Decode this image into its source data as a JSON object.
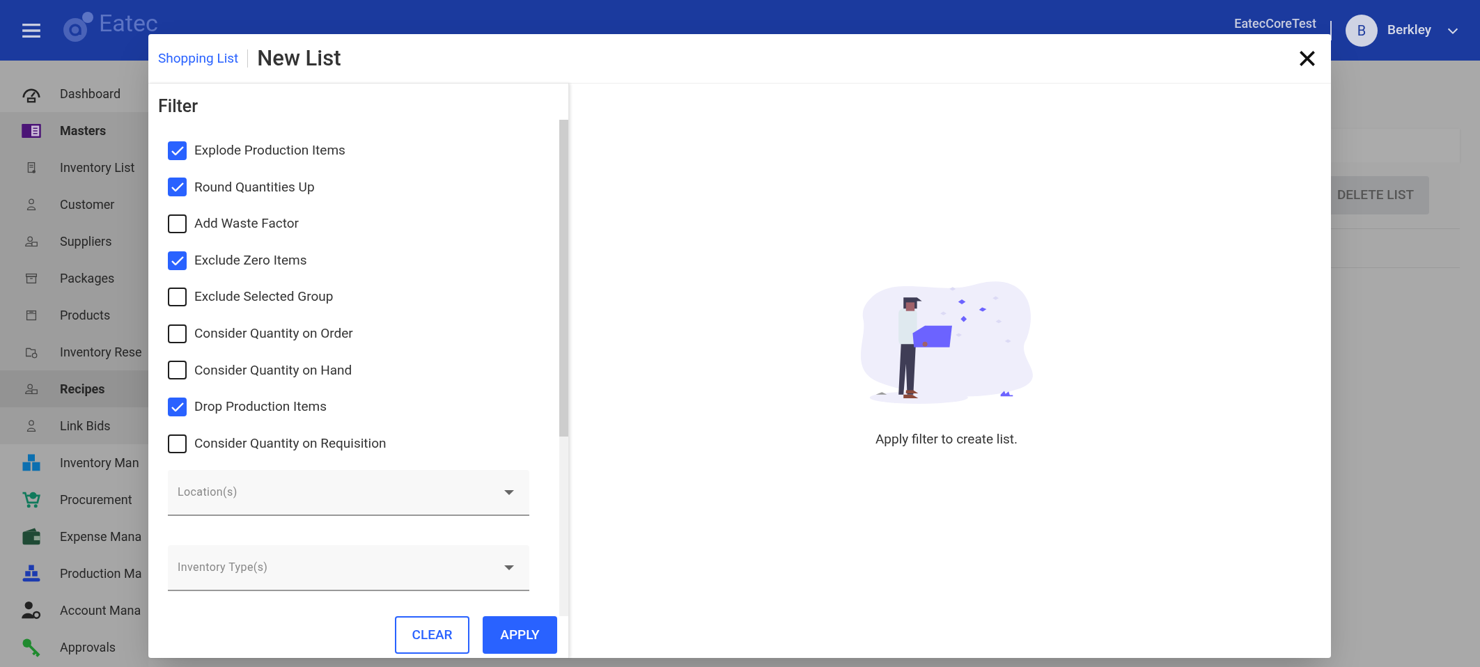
{
  "top_bar": {
    "app_name": "Eatec",
    "tenant": "EatecCoreTest",
    "user": {
      "initial": "B",
      "name": "Berkley"
    }
  },
  "sidebar": {
    "items": [
      {
        "label": "Dashboard",
        "kind": "link"
      },
      {
        "label": "Masters",
        "kind": "section",
        "expanded": true
      },
      {
        "label": "Inventory List",
        "kind": "subitem",
        "selected": false
      },
      {
        "label": "Customer",
        "kind": "subitem",
        "selected": false
      },
      {
        "label": "Suppliers",
        "kind": "subitem",
        "selected": false
      },
      {
        "label": "Packages",
        "kind": "subitem",
        "selected": false
      },
      {
        "label": "Products",
        "kind": "subitem",
        "selected": false
      },
      {
        "label": "Inventory Rese",
        "kind": "subitem",
        "selected": false
      },
      {
        "label": "Recipes",
        "kind": "subitem",
        "selected": true
      },
      {
        "label": "Link Bids",
        "kind": "subitem",
        "selected": false
      },
      {
        "label": "Inventory Man",
        "kind": "section",
        "expanded": false
      },
      {
        "label": "Procurement",
        "kind": "section",
        "expanded": false
      },
      {
        "label": "Expense Mana",
        "kind": "section",
        "expanded": false
      },
      {
        "label": "Production Ma",
        "kind": "section",
        "expanded": false
      },
      {
        "label": "Account Mana",
        "kind": "section",
        "expanded": false
      },
      {
        "label": "Approvals",
        "kind": "section",
        "expanded": false
      }
    ]
  },
  "background": {
    "delete_button": {
      "label": "DELETE LIST",
      "disabled": true
    }
  },
  "dialog": {
    "breadcrumb": "Shopping List",
    "title": "New List",
    "filter": {
      "title": "Filter",
      "options": [
        {
          "label": "Explode Production Items",
          "checked": true
        },
        {
          "label": "Round Quantities Up",
          "checked": true
        },
        {
          "label": "Add Waste Factor",
          "checked": false
        },
        {
          "label": "Exclude Zero Items",
          "checked": true
        },
        {
          "label": "Exclude Selected Group",
          "checked": false
        },
        {
          "label": "Consider Quantity on Order",
          "checked": false
        },
        {
          "label": "Consider Quantity on Hand",
          "checked": false
        },
        {
          "label": "Drop Production Items",
          "checked": true
        },
        {
          "label": "Consider Quantity on Requisition",
          "checked": false
        }
      ],
      "selects": [
        {
          "placeholder": "Location(s)"
        },
        {
          "placeholder": "Inventory Type(s)"
        }
      ],
      "buttons": [
        {
          "label": "CLEAR",
          "kind": "outlined"
        },
        {
          "label": "APPLY",
          "kind": "filled"
        }
      ]
    },
    "empty_state": {
      "message": "Apply filter to create list."
    }
  }
}
